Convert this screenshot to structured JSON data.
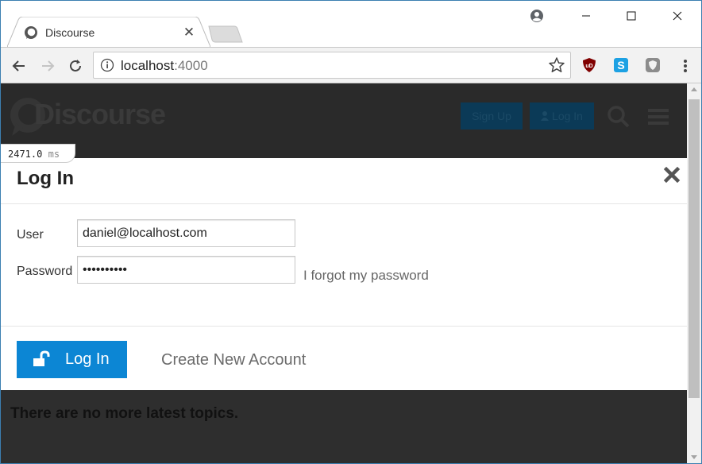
{
  "tab": {
    "title": "Discourse",
    "close_glyph": "✕"
  },
  "omnibox": {
    "host": "localhost",
    "port": ":4000"
  },
  "header": {
    "logo_text": "Discourse",
    "signup_label": "Sign Up",
    "login_label": "Log In"
  },
  "timing": {
    "value": "2471.0",
    "unit": "ms"
  },
  "modal": {
    "title": "Log In",
    "user_label": "User",
    "user_value": "daniel@localhost.com",
    "password_label": "Password",
    "password_value": "••••••••••",
    "forgot_label": "I forgot my password",
    "login_button_label": "Log In",
    "create_account_label": "Create New Account"
  },
  "page": {
    "empty_message": "There are no more latest topics."
  },
  "colors": {
    "accent": "#0c86d4",
    "window_border": "#3c7fb1",
    "page_dark": "#2e2e2e"
  }
}
